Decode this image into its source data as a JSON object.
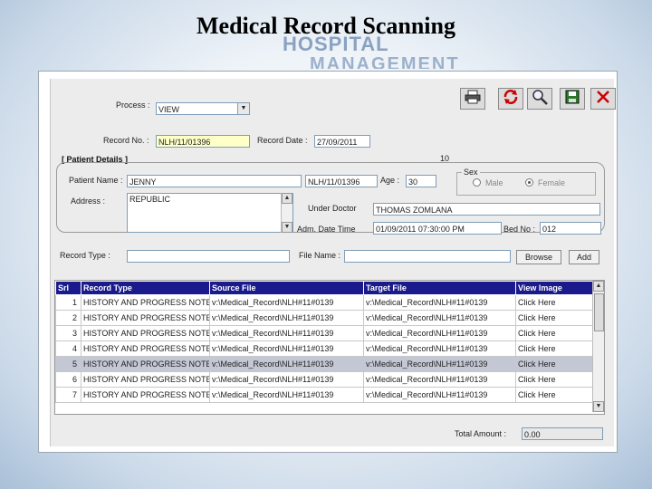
{
  "slide": {
    "title": "Medical Record Scanning",
    "watermark_line1": "HOSPITAL",
    "watermark_line2": "MANAGEMENT"
  },
  "toolbar": {
    "icons": [
      "printer-icon",
      "refresh-icon",
      "search-icon",
      "save-icon",
      "close-icon"
    ]
  },
  "form": {
    "process_label": "Process :",
    "process_value": "VIEW",
    "record_no_label": "Record No. :",
    "record_no_value": "NLH/11/01396",
    "record_date_label": "Record Date :",
    "record_date_value": "27/09/2011",
    "section_title": "[ Patient Details ]",
    "marker": "10",
    "patient_name_label": "Patient Name :",
    "patient_name_value": "JENNY",
    "patient_id_value": "NLH/11/01396",
    "age_label": "Age :",
    "age_value": "30",
    "sex_label": "Sex",
    "sex_options": [
      "Male",
      "Female"
    ],
    "sex_selected": "Female",
    "address_label": "Address :",
    "address_value": "REPUBLIC",
    "under_doctor_label": "Under Doctor",
    "under_doctor_value": "THOMAS ZOMLANA",
    "adm_label": "Adm. Date Time",
    "adm_value": "01/09/2011 07:30:00 PM",
    "bed_label": "Bed No :",
    "bed_value": "012",
    "record_type_label": "Record Type :",
    "record_type_value": "",
    "file_name_label": "File Name :",
    "file_name_value": "",
    "browse_label": "Browse",
    "add_label": "Add"
  },
  "table": {
    "columns": [
      "Srl",
      "Record Type",
      "Source File",
      "Target File",
      "View Image"
    ],
    "rows": [
      {
        "srl": "1",
        "type": "HISTORY AND PROGRESS NOTE",
        "source": "v:\\Medical_Record\\NLH#11#0139",
        "target": "v:\\Medical_Record\\NLH#11#0139",
        "view": "Click Here"
      },
      {
        "srl": "2",
        "type": "HISTORY AND PROGRESS NOTE",
        "source": "v:\\Medical_Record\\NLH#11#0139",
        "target": "v:\\Medical_Record\\NLH#11#0139",
        "view": "Click Here"
      },
      {
        "srl": "3",
        "type": "HISTORY AND PROGRESS NOTE",
        "source": "v:\\Medical_Record\\NLH#11#0139",
        "target": "v:\\Medical_Record\\NLH#11#0139",
        "view": "Click Here"
      },
      {
        "srl": "4",
        "type": "HISTORY AND PROGRESS NOTE",
        "source": "v:\\Medical_Record\\NLH#11#0139",
        "target": "v:\\Medical_Record\\NLH#11#0139",
        "view": "Click Here"
      },
      {
        "srl": "5",
        "type": "HISTORY AND PROGRESS NOTE",
        "source": "v:\\Medical_Record\\NLH#11#0139",
        "target": "v:\\Medical_Record\\NLH#11#0139",
        "view": "Click Here"
      },
      {
        "srl": "6",
        "type": "HISTORY AND PROGRESS NOTE",
        "source": "v:\\Medical_Record\\NLH#11#0139",
        "target": "v:\\Medical_Record\\NLH#11#0139",
        "view": "Click Here"
      },
      {
        "srl": "7",
        "type": "HISTORY AND PROGRESS NOTE",
        "source": "v:\\Medical_Record\\NLH#11#0139",
        "target": "v:\\Medical_Record\\NLH#11#0139",
        "view": "Click Here"
      }
    ],
    "highlighted_row": 4
  },
  "footer": {
    "total_label": "Total Amount :",
    "total_value": "0.00"
  },
  "colors": {
    "header_bg": "#1a1a8c",
    "highlight_row": "#c3c8d4",
    "record_no_bg": "#ffffc8"
  }
}
